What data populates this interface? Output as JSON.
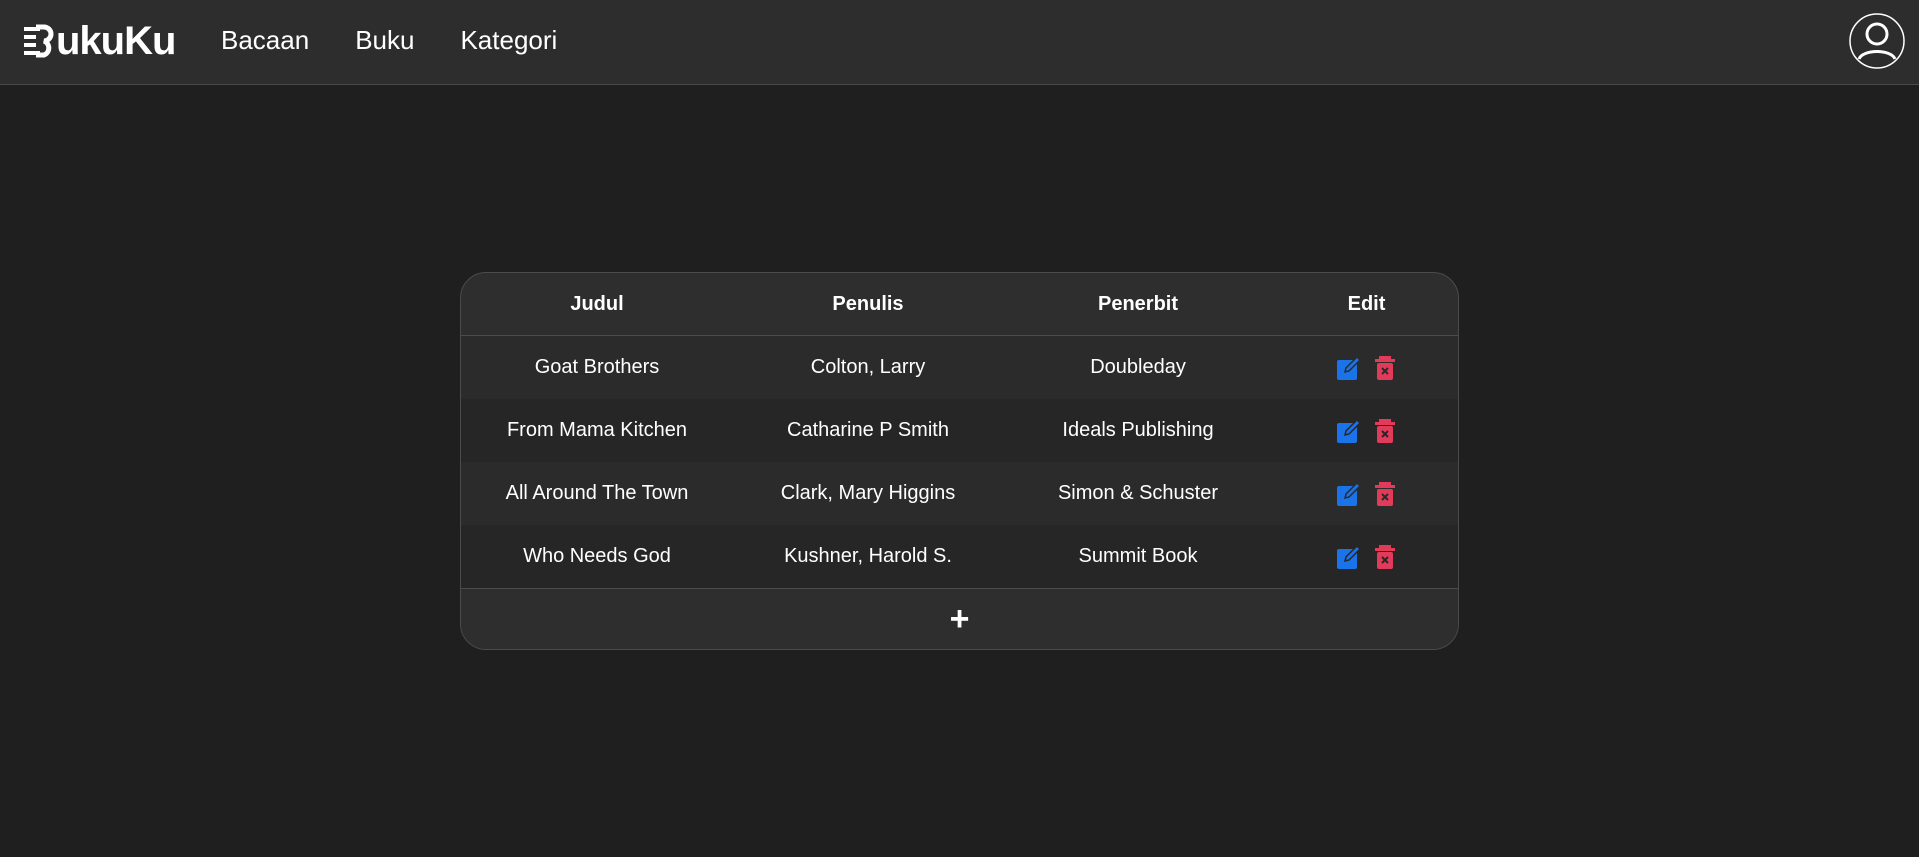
{
  "app": {
    "brand": "BukuKu",
    "logo_letter_remainder": "ukuKu",
    "colors": {
      "background": "#1f1f1f",
      "topbar": "#2d2d2d",
      "edit_icon": "#1a73e8",
      "delete_icon": "#e23b5a"
    }
  },
  "nav": {
    "items": [
      {
        "label": "Bacaan"
      },
      {
        "label": "Buku"
      },
      {
        "label": "Kategori"
      }
    ]
  },
  "user": {
    "icon": "user-avatar-icon"
  },
  "table": {
    "headers": [
      "Judul",
      "Penulis",
      "Penerbit",
      "Edit"
    ],
    "rows": [
      {
        "judul": "Goat Brothers",
        "penulis": "Colton, Larry",
        "penerbit": "Doubleday"
      },
      {
        "judul": "From Mama Kitchen",
        "penulis": "Catharine P Smith",
        "penerbit": "Ideals Publishing"
      },
      {
        "judul": "All Around The Town",
        "penulis": "Clark, Mary Higgins",
        "penerbit": "Simon & Schuster"
      },
      {
        "judul": "Who Needs God",
        "penulis": "Kushner, Harold S.",
        "penerbit": "Summit Book"
      }
    ],
    "edit_icon": "edit-icon",
    "delete_icon": "trash-icon",
    "add_label": "+"
  }
}
